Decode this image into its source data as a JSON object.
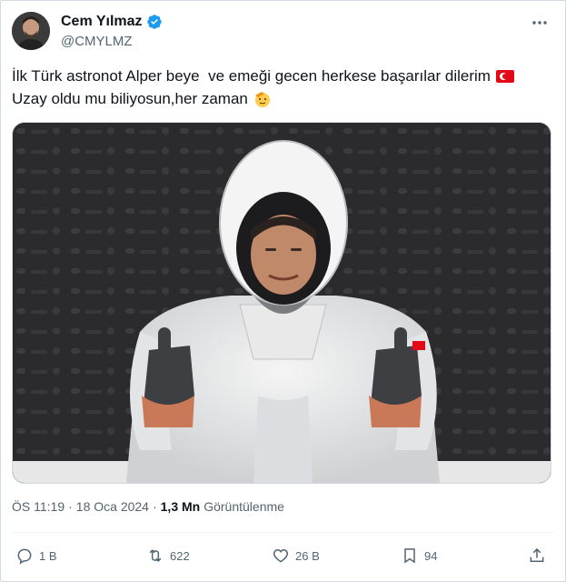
{
  "author": {
    "display_name": "Cem Yılmaz",
    "handle": "@CMYLMZ",
    "verified_icon": "verified-badge-icon",
    "avatar_icon": "avatar"
  },
  "tweet": {
    "line1": "İlk Türk astronot Alper beye  ve emeği gecen herkese başarılar dilerim",
    "line2": "Uzay oldu mu biliyosun,her zaman",
    "line1_emoji": "turkey-flag-icon",
    "line2_emoji": "saluting-face-icon"
  },
  "meta": {
    "time": "ÖS 11:19",
    "date": "18 Oca 2024",
    "views_count": "1,3 Mn",
    "views_label": "Görüntülenme"
  },
  "actions": {
    "replies": "1 B",
    "retweets": "622",
    "likes": "26 B",
    "bookmarks": "94"
  },
  "colors": {
    "accent": "#1d9bf0",
    "secondary_text": "#536471",
    "border": "#cfd9de"
  }
}
